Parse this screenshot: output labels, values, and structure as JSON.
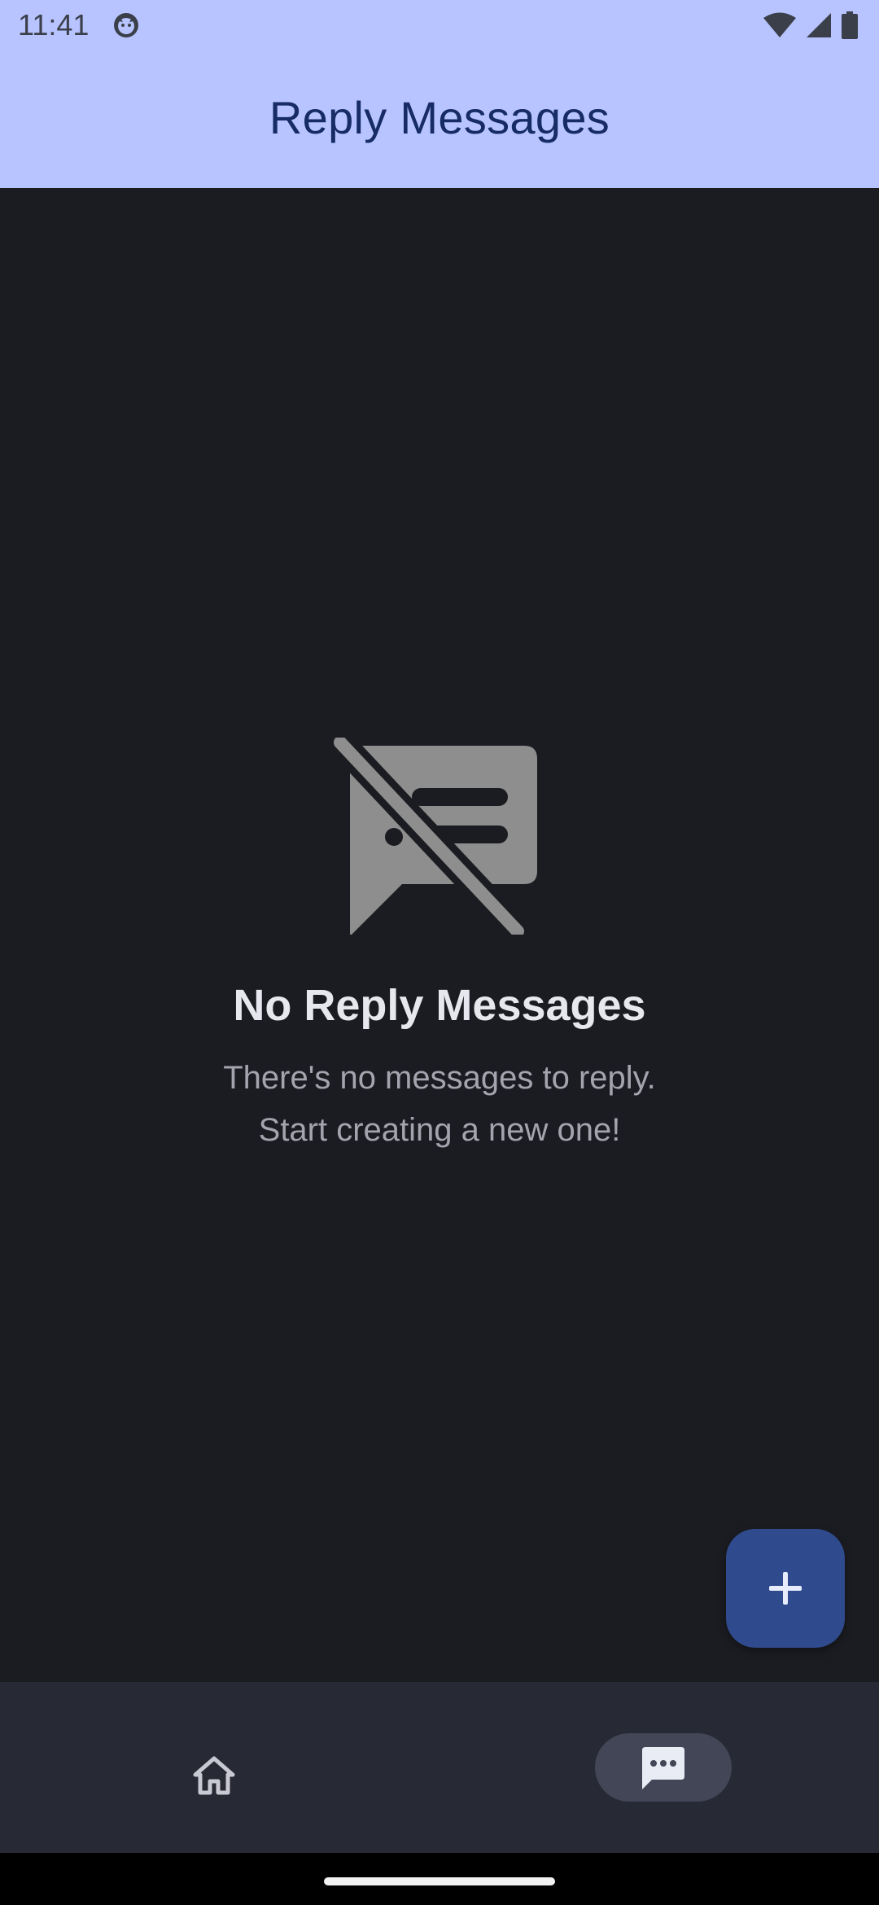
{
  "status_bar": {
    "time": "11:41",
    "icons": [
      "notification-cat-icon",
      "wifi-icon",
      "cell-signal-icon",
      "battery-icon"
    ]
  },
  "app_bar": {
    "title": "Reply Messages"
  },
  "empty_state": {
    "icon": "message-off-icon",
    "title": "No Reply Messages",
    "line1": "There's no messages to reply.",
    "line2": "Start creating a new one!"
  },
  "fab": {
    "icon": "plus-icon"
  },
  "bottom_nav": {
    "items": [
      {
        "id": "home",
        "icon": "home-icon",
        "selected": false
      },
      {
        "id": "messages",
        "icon": "message-icon",
        "selected": true
      }
    ]
  },
  "colors": {
    "top_bar": "#b7c4ff",
    "title": "#172b66",
    "background": "#1b1c21",
    "fab": "#2f4b8e",
    "nav_bar": "#272934",
    "nav_selected_pill": "#424656",
    "empty_icon": "#8e8e8e"
  }
}
